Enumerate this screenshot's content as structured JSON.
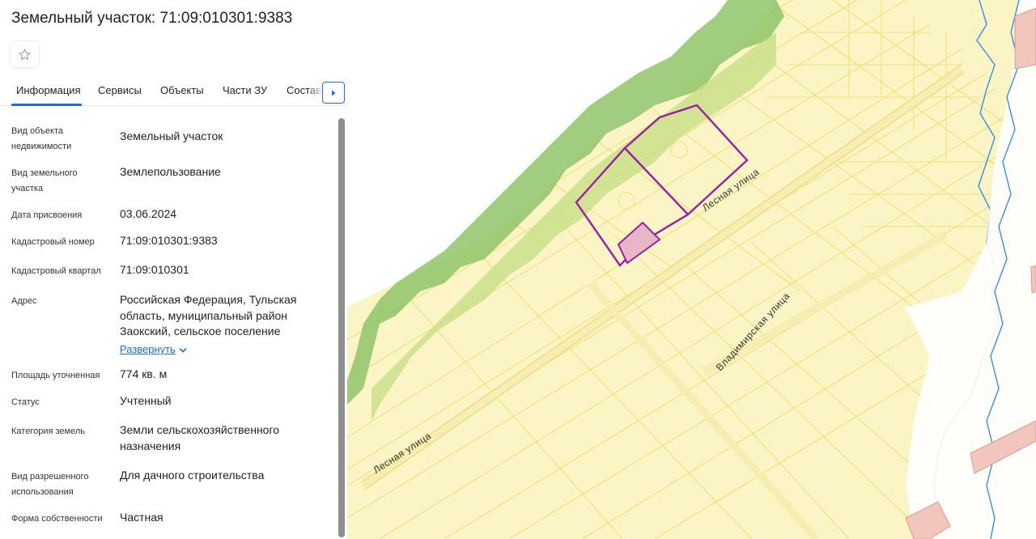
{
  "header": {
    "title": "Земельный участок: 71:09:010301:9383",
    "favorite_icon": "star-outline-icon"
  },
  "tabs": [
    {
      "label": "Информация",
      "active": true
    },
    {
      "label": "Сервисы"
    },
    {
      "label": "Объекты"
    },
    {
      "label": "Части ЗУ"
    },
    {
      "label": "Состав"
    }
  ],
  "tabs_next_icon": "chevron-right-icon",
  "info": [
    {
      "label": "Вид объекта недвижимости",
      "value": "Земельный участок"
    },
    {
      "label": "Вид земельного участка",
      "value": "Землепользование"
    },
    {
      "label": "Дата присвоения",
      "value": "03.06.2024"
    },
    {
      "label": "Кадастровый номер",
      "value": "71:09:010301:9383"
    },
    {
      "label": "Кадастровый квартал",
      "value": "71:09:010301"
    },
    {
      "label": "Адрес",
      "value": "Российская Федерация, Тульская область, муниципальный район Заокский, сельское поселение",
      "expand_label": "Развернуть"
    },
    {
      "label": "Площадь уточненная",
      "value": "774 кв. м"
    },
    {
      "label": "Статус",
      "value": "Учтенный"
    },
    {
      "label": "Категория земель",
      "value": "Земли сельскохозяйственного назначения"
    },
    {
      "label": "Вид разрешенного использования",
      "value": "Для дачного строительства"
    },
    {
      "label": "Форма собственности",
      "value": "Частная"
    }
  ],
  "map": {
    "streets": [
      "Лесная улица",
      "Владимирская улица",
      "Лесная улица"
    ],
    "colors": {
      "parcel_fill": "#fbf5c6",
      "parcel_line": "#f0df78",
      "forest": "#8fc46a",
      "water": "#ffffff",
      "selected_outline": "#9a1fa3",
      "selected_fill": "#e7b7c8",
      "river_line": "#3a8ee0",
      "building": "#f3c6bd"
    }
  }
}
